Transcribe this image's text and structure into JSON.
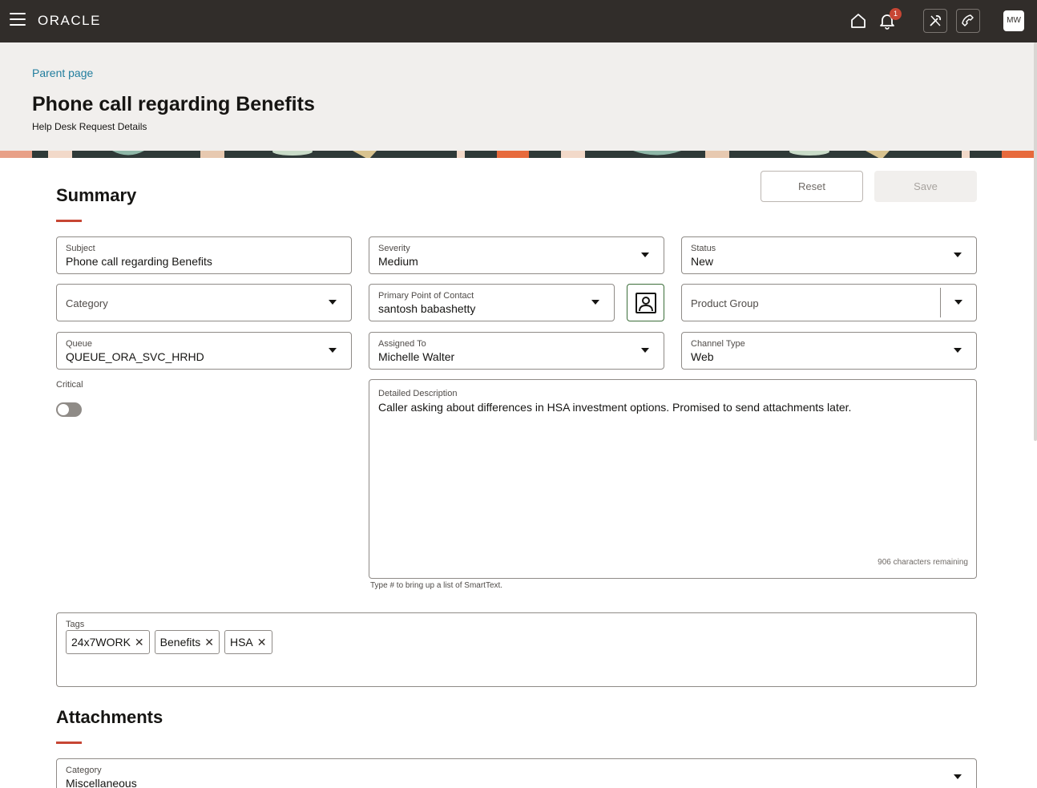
{
  "topbar": {
    "logo": "ORACLE",
    "notification_count": "1",
    "avatar_initials": "MW"
  },
  "header": {
    "breadcrumb": "Parent page",
    "title": "Phone call regarding Benefits",
    "subtitle": "Help Desk Request Details"
  },
  "summary": {
    "title": "Summary",
    "reset_label": "Reset",
    "save_label": "Save",
    "subject": {
      "label": "Subject",
      "value": "Phone call regarding Benefits"
    },
    "severity": {
      "label": "Severity",
      "value": "Medium"
    },
    "status": {
      "label": "Status",
      "value": "New"
    },
    "category": {
      "label": "Category"
    },
    "primary_contact": {
      "label": "Primary Point of Contact",
      "value": "santosh babashetty"
    },
    "product_group": {
      "label": "Product Group"
    },
    "queue": {
      "label": "Queue",
      "value": "QUEUE_ORA_SVC_HRHD"
    },
    "assigned_to": {
      "label": "Assigned To",
      "value": "Michelle Walter"
    },
    "channel_type": {
      "label": "Channel Type",
      "value": "Web"
    },
    "critical": {
      "label": "Critical",
      "value": false
    },
    "description": {
      "label": "Detailed Description",
      "value": "Caller asking about differences in HSA investment options. Promised to send attachments later.",
      "remaining": "906 characters remaining",
      "hint": "Type # to bring up a list of SmartText."
    },
    "tags": {
      "label": "Tags",
      "items": [
        "24x7WORK",
        "Benefits",
        "HSA"
      ]
    }
  },
  "attachments": {
    "title": "Attachments",
    "category": {
      "label": "Category",
      "value": "Miscellaneous"
    }
  },
  "colors": {
    "topbar": "#312d2a",
    "accent": "#c74634",
    "link": "#227e9e",
    "header_bg": "#f1efed"
  }
}
